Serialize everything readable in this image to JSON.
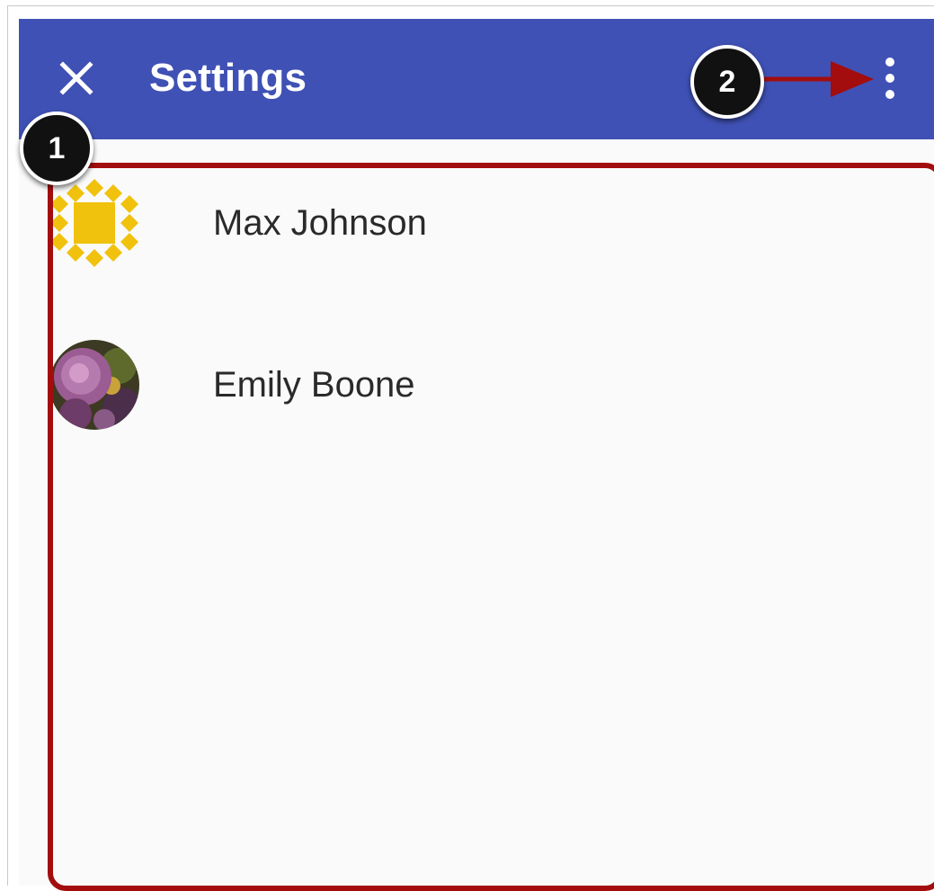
{
  "header": {
    "title": "Settings",
    "close_icon": "close-icon",
    "overflow_icon": "more-vert-icon"
  },
  "accounts": [
    {
      "name": "Max Johnson",
      "avatar": "yellow-pattern-avatar"
    },
    {
      "name": "Emily Boone",
      "avatar": "flower-photo-avatar"
    }
  ],
  "callouts": [
    "1",
    "2"
  ],
  "colors": {
    "toolbar": "#3f51b5",
    "callout_highlight": "#a30d0d",
    "avatar_yellow": "#f0c20e",
    "background": "#fafafa"
  }
}
